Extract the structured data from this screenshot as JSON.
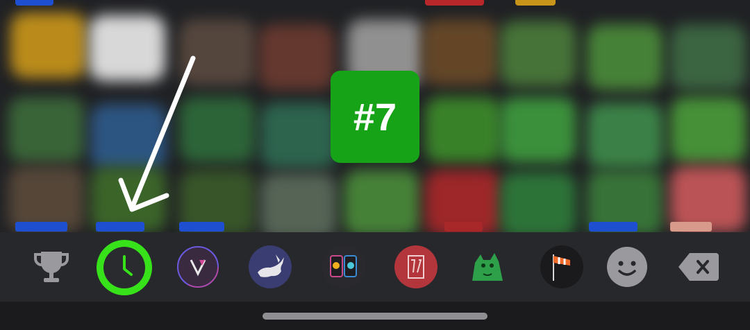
{
  "badge": {
    "text": "#7",
    "color": "#17a317"
  },
  "toolbar": {
    "items": [
      {
        "name": "trophy-icon",
        "selected": false
      },
      {
        "name": "recent-clock-icon",
        "selected": true,
        "accent": "#37e21a"
      },
      {
        "name": "sticker-pack-v-icon",
        "selected": false
      },
      {
        "name": "sticker-pack-rabbit-icon",
        "selected": false
      },
      {
        "name": "sticker-pack-phones-icon",
        "selected": false
      },
      {
        "name": "sticker-pack-red-icon",
        "selected": false
      },
      {
        "name": "sticker-pack-green-dog-icon",
        "selected": false
      },
      {
        "name": "sticker-pack-windsock-icon",
        "selected": false
      },
      {
        "name": "emoji-smile-icon",
        "selected": false
      },
      {
        "name": "backspace-icon",
        "selected": false
      }
    ]
  }
}
